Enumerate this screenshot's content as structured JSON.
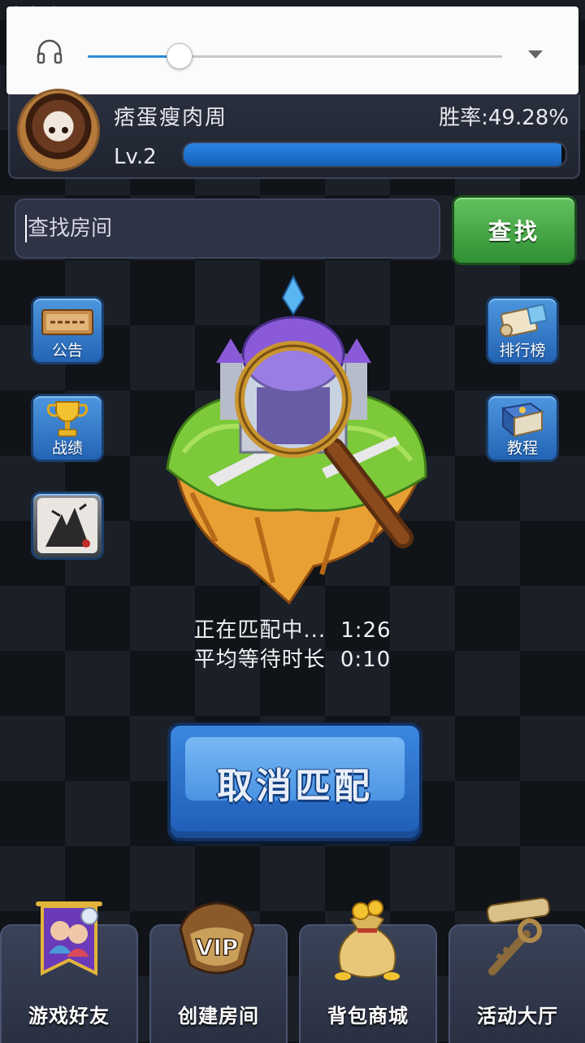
{
  "status_bar": {
    "text": "音乐服务器:"
  },
  "volume": {
    "level": 0.22
  },
  "profile": {
    "name": "痞蛋瘦肉周",
    "win_rate": "胜率:49.28%",
    "level": "Lv.2",
    "xp_progress": 0.99
  },
  "search": {
    "placeholder": "查找房间",
    "button_label": "查找"
  },
  "side_buttons": [
    {
      "label": "公告",
      "icon": "notice-board-icon"
    },
    {
      "label": "战绩",
      "icon": "trophy-icon"
    },
    {
      "label": "",
      "icon": "game-promo-icon"
    },
    {
      "label": "排行榜",
      "icon": "scroll-icon"
    },
    {
      "label": "教程",
      "icon": "book-icon"
    }
  ],
  "matching": {
    "status_label": "正在匹配中...",
    "elapsed": "1:26",
    "avg_label": "平均等待时长",
    "avg_time": "0:10"
  },
  "cancel_button": {
    "label": "取消匹配"
  },
  "bottom_nav": [
    {
      "label": "游戏好友",
      "icon": "friends-banner-icon"
    },
    {
      "label": "创建房间",
      "icon": "vip-badge-icon"
    },
    {
      "label": "背包商城",
      "icon": "money-bag-icon"
    },
    {
      "label": "活动大厅",
      "icon": "scroll-key-icon"
    }
  ],
  "colors": {
    "accent_blue": "#2a86e2",
    "search_green": "#3fa33f",
    "panel": "#2e3346"
  }
}
